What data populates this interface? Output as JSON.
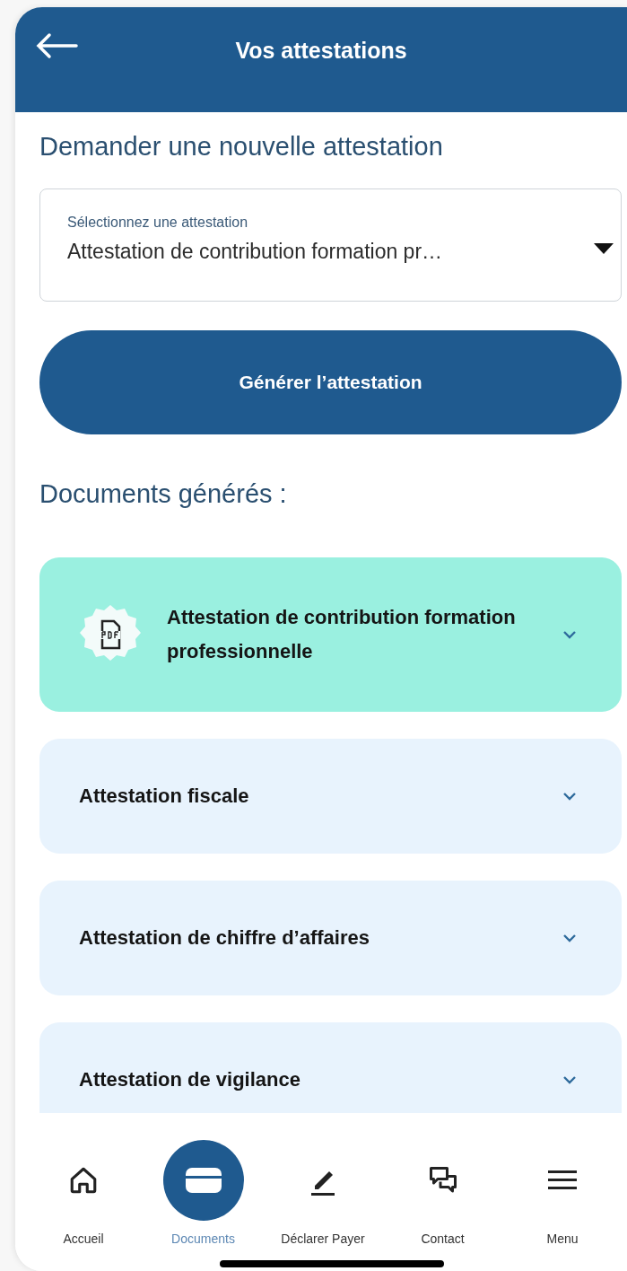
{
  "header": {
    "title": "Vos attestations"
  },
  "request": {
    "heading": "Demander une nouvelle attestation",
    "select": {
      "label": "Sélectionnez une attestation",
      "value": "Attestation de contribution formation pr…"
    },
    "button": "Générer l’attestation"
  },
  "documents": {
    "heading": "Documents générés :",
    "items": [
      {
        "title": "Attestation de contribution formation professionnelle",
        "selected": true
      },
      {
        "title": "Attestation fiscale",
        "selected": false
      },
      {
        "title": "Attestation de chiffre d’affaires",
        "selected": false
      },
      {
        "title": "Attestation de vigilance",
        "selected": false
      }
    ]
  },
  "nav": [
    {
      "kind": "home",
      "label": "Accueil",
      "selected": false
    },
    {
      "kind": "folder",
      "label": "Documents",
      "selected": true
    },
    {
      "kind": "pen",
      "label": "Déclarer Payer",
      "selected": false
    },
    {
      "kind": "chat",
      "label": "Contact",
      "selected": false
    },
    {
      "kind": "menu",
      "label": "Menu",
      "selected": false
    }
  ]
}
